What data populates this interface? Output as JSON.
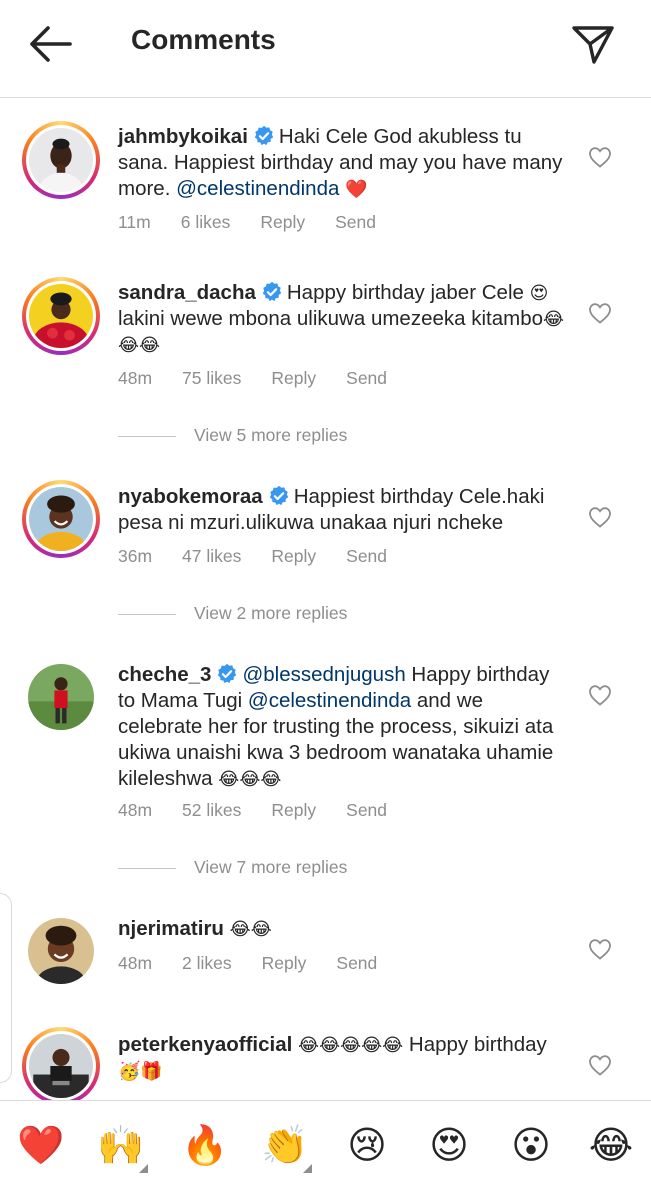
{
  "header": {
    "title": "Comments"
  },
  "comments": [
    {
      "username": "jahmbykoikai",
      "text_before": "Haki Cele God akubless tu sana. Happiest birthday and may you have many more. ",
      "mention": "@celestinendinda",
      "text_after": " ",
      "emojis": "❤️",
      "time": "11m",
      "likes": "6 likes"
    },
    {
      "username": "sandra_dacha",
      "text_before": "Happy birthday jaber Cele ",
      "emoji_mid": "😍",
      "text_after": " lakini wewe mbona ulikuwa umezeeka kitambo",
      "emojis": "😂😂😂",
      "time": "48m",
      "likes": "75 likes",
      "more_replies": "View 5 more replies"
    },
    {
      "username": "nyabokemoraa",
      "text_before": "Happiest birthday Cele.haki pesa ni mzuri.ulikuwa unakaa njuri ncheke",
      "time": "36m",
      "likes": "47 likes",
      "more_replies": "View 2 more replies"
    },
    {
      "username": "cheche_3",
      "mention1": "@blessednjugush",
      "text_mid": " Happy birthday to Mama Tugi ",
      "mention2": "@celestinendinda",
      "text_after": " and we celebrate her for trusting the process, sikuizi ata ukiwa unaishi kwa 3 bedroom wanataka uhamie kileleshwa ",
      "emojis": "😂😂😂",
      "time": "48m",
      "likes": "52 likes",
      "more_replies": "View 7 more replies"
    },
    {
      "username": "njerimatiru",
      "emojis": "😂😂",
      "time": "48m",
      "likes": "2 likes"
    },
    {
      "username": "peterkenyaofficial",
      "emojis": "😂😂😂😂😂",
      "text_after": " Happy birthday ",
      "emojis_end": "🥳🎁"
    }
  ],
  "actions": {
    "reply": "Reply",
    "send": "Send"
  },
  "quick_emojis": [
    "❤️",
    "🙌",
    "🔥",
    "👏",
    "😢",
    "😍",
    "😮",
    "😂"
  ],
  "colors": {
    "mention": "#00376b",
    "meta": "#8e8e8e",
    "verified": "#3897f0",
    "heart": "#ed4956"
  }
}
